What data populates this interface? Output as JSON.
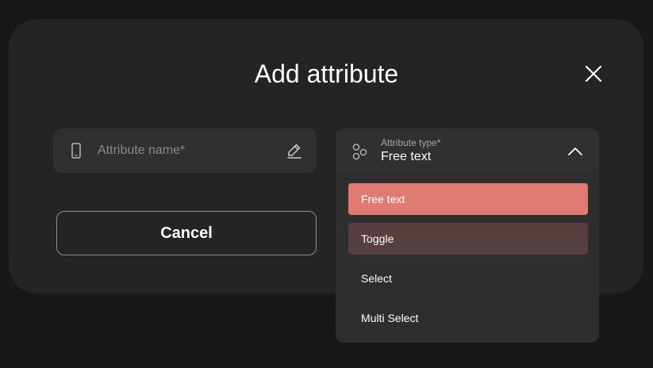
{
  "dialog": {
    "title": "Add attribute",
    "close_icon": "close-icon"
  },
  "attribute_name": {
    "placeholder": "Attribute name*",
    "value": "",
    "leading_icon": "phone-icon",
    "trailing_icon": "edit-icon"
  },
  "attribute_type": {
    "label": "Attribute type*",
    "selected": "Free text",
    "leading_icon": "attribute-type-icon",
    "trailing_icon": "chevron-up-icon",
    "options": [
      {
        "label": "Free text",
        "state": "selected"
      },
      {
        "label": "Toggle",
        "state": "hover"
      },
      {
        "label": "Select",
        "state": "normal"
      },
      {
        "label": "Multi Select",
        "state": "normal"
      }
    ]
  },
  "actions": {
    "cancel_label": "Cancel"
  },
  "colors": {
    "background": "#181818",
    "modal": "#242424",
    "field": "#303030",
    "selected_option": "#e07b74",
    "hover_option": "#563f3e"
  }
}
